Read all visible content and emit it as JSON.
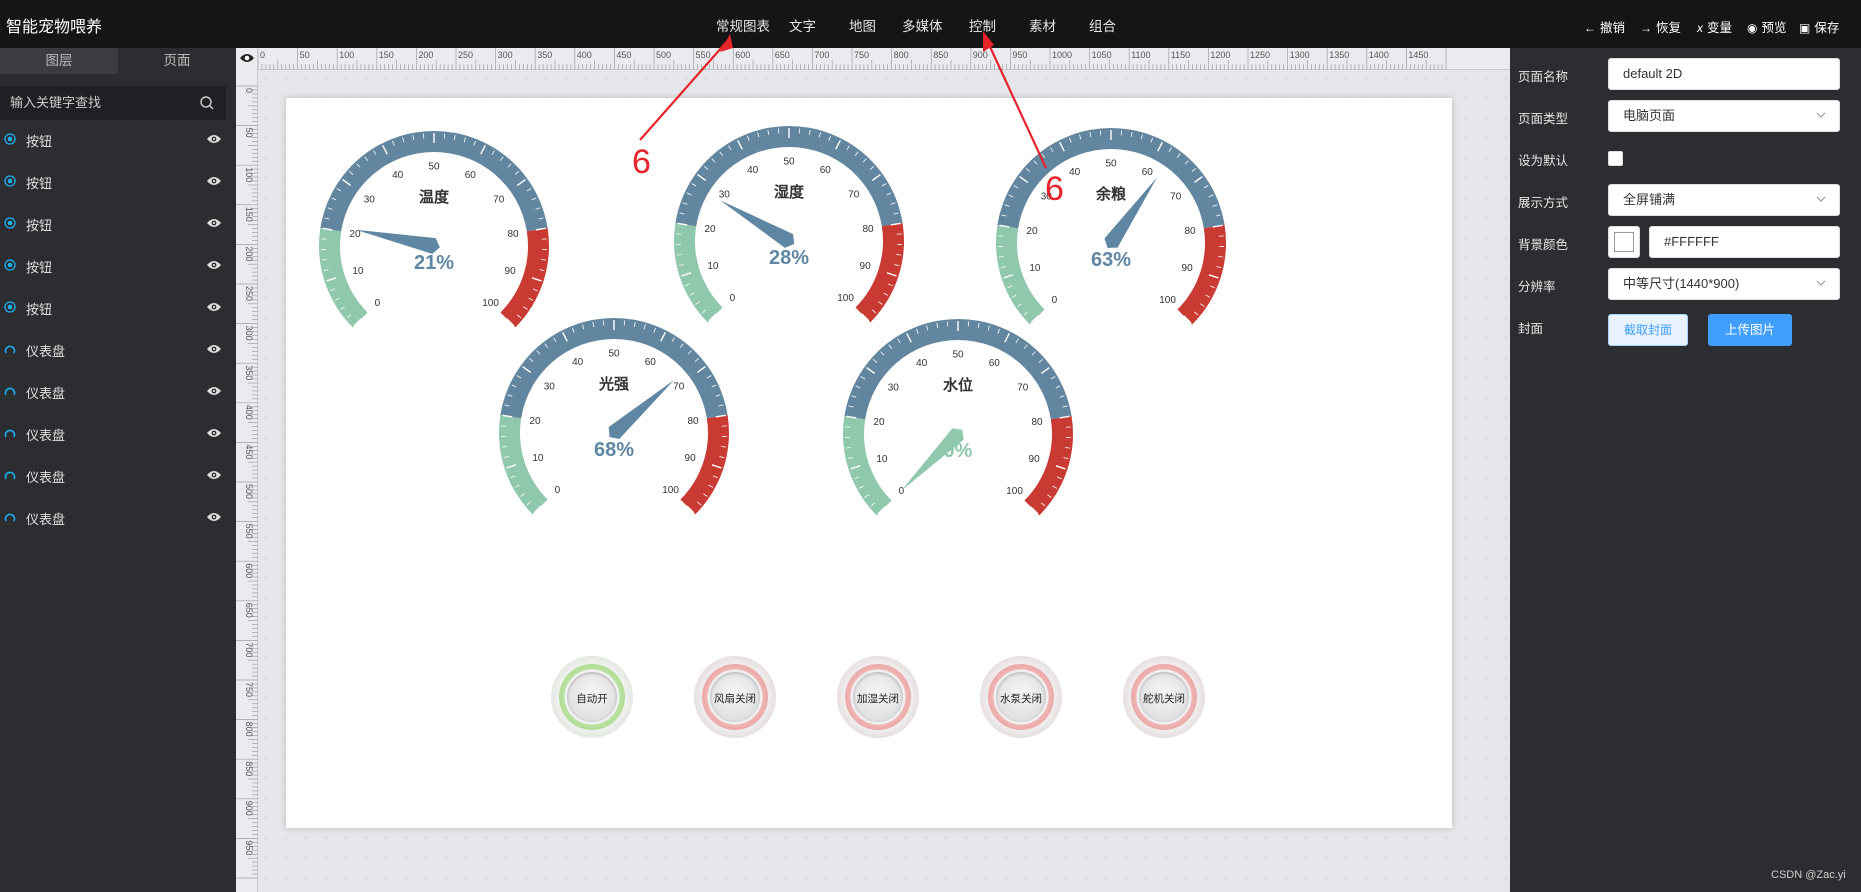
{
  "app": {
    "title": "智能宠物喂养"
  },
  "nav": {
    "items": [
      {
        "label": "常规图表"
      },
      {
        "label": "文字"
      },
      {
        "label": "地图"
      },
      {
        "label": "多媒体"
      },
      {
        "label": "控制"
      },
      {
        "label": "素材"
      },
      {
        "label": "组合"
      }
    ]
  },
  "toolbar": {
    "undo": "撤销",
    "redo": "恢复",
    "variable": "变量",
    "preview": "预览",
    "save": "保存"
  },
  "sidebar": {
    "tabs": [
      "图层",
      "页面"
    ],
    "search_placeholder": "输入关键字查找",
    "layers": [
      {
        "label": "按钮",
        "type": "button"
      },
      {
        "label": "按钮",
        "type": "button"
      },
      {
        "label": "按钮",
        "type": "button"
      },
      {
        "label": "按钮",
        "type": "button"
      },
      {
        "label": "按钮",
        "type": "button"
      },
      {
        "label": "仪表盘",
        "type": "gauge"
      },
      {
        "label": "仪表盘",
        "type": "gauge"
      },
      {
        "label": "仪表盘",
        "type": "gauge"
      },
      {
        "label": "仪表盘",
        "type": "gauge"
      },
      {
        "label": "仪表盘",
        "type": "gauge"
      }
    ]
  },
  "rulers": {
    "top": [
      "0",
      "50",
      "100",
      "150",
      "200",
      "250",
      "300",
      "350",
      "400",
      "450",
      "500",
      "550",
      "600",
      "650",
      "700",
      "750",
      "800",
      "850",
      "900",
      "950",
      "1000",
      "1050",
      "1100",
      "1150",
      "1200",
      "1250",
      "1300",
      "1350",
      "1400",
      "1450"
    ],
    "left": [
      "0",
      "50",
      "100",
      "150",
      "200",
      "250",
      "300",
      "350",
      "400",
      "450",
      "500",
      "550",
      "600",
      "650",
      "700",
      "750",
      "800",
      "850",
      "900",
      "950"
    ]
  },
  "gauges": [
    {
      "title": "温度",
      "value": 21,
      "value_text": "21%",
      "pointer_color": "#5f87a3",
      "value_color": "#5f87a3"
    },
    {
      "title": "湿度",
      "value": 28,
      "value_text": "28%",
      "pointer_color": "#5f87a3",
      "value_color": "#5f87a3"
    },
    {
      "title": "余粮",
      "value": 63,
      "value_text": "63%",
      "pointer_color": "#5f87a3",
      "value_color": "#5f87a3"
    },
    {
      "title": "光强",
      "value": 68,
      "value_text": "68%",
      "pointer_color": "#5f87a3",
      "value_color": "#5f87a3"
    },
    {
      "title": "水位",
      "value": 0,
      "value_text": "0%",
      "pointer_color": "#8fc8ac",
      "value_color": "#8fc8ac"
    }
  ],
  "gauge_scale": {
    "ticks": [
      "0",
      "10",
      "20",
      "30",
      "40",
      "50",
      "60",
      "70",
      "80",
      "90",
      "100"
    ],
    "band_colors": {
      "low": "#8fc8ac",
      "mid": "#62869f",
      "high": "#c93a33"
    }
  },
  "controls": [
    {
      "label": "自动开",
      "state": "on"
    },
    {
      "label": "风扇关闭",
      "state": "off"
    },
    {
      "label": "加湿关闭",
      "state": "off"
    },
    {
      "label": "水泵关闭",
      "state": "off"
    },
    {
      "label": "舵机关闭",
      "state": "off"
    }
  ],
  "annotations": [
    {
      "text": "6"
    },
    {
      "text": "6"
    }
  ],
  "properties": {
    "page_name_label": "页面名称",
    "page_name_value": "default 2D",
    "page_type_label": "页面类型",
    "page_type_value": "电脑页面",
    "set_default_label": "设为默认",
    "display_label": "展示方式",
    "display_value": "全屏铺满",
    "bg_color_label": "背景颜色",
    "bg_color_value": "#FFFFFF",
    "resolution_label": "分辨率",
    "resolution_value": "中等尺寸(1440*900)",
    "cover_label": "封面",
    "capture_button": "截取封面",
    "upload_button": "上传图片"
  },
  "watermark": "CSDN @Zac.yi",
  "colors": {
    "accent": "#409eff",
    "annotation": "#e8232a"
  }
}
